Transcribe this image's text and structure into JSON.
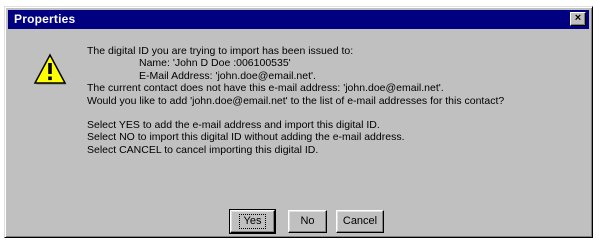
{
  "window": {
    "title": "Properties",
    "close_glyph": "×"
  },
  "icon": {
    "name": "warning-icon",
    "glyph": "!",
    "fill_color": "#ffff00"
  },
  "message": {
    "line1": "The digital ID you are trying to import has been issued to:",
    "name_line": "Name: 'John D Doe :006100535'",
    "email_line": "E-Mail Address: 'john.doe@email.net'.",
    "line4": "The current contact does not have this e-mail address: 'john.doe@email.net'.",
    "line5": "Would you like to add 'john.doe@email.net' to the list of e-mail addresses for this contact?",
    "line6": "Select YES to add the e-mail address and import this digital ID.",
    "line7": "Select NO to import this digital ID without adding the e-mail address.",
    "line8": "Select CANCEL to cancel importing this digital ID."
  },
  "buttons": {
    "yes": "Yes",
    "no": "No",
    "cancel": "Cancel"
  }
}
